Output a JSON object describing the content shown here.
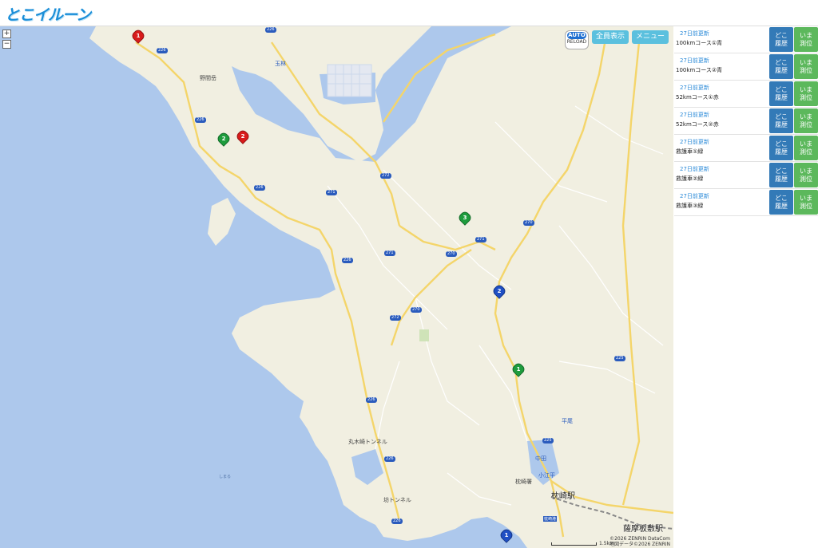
{
  "app": {
    "logo_text": "とこイルーン"
  },
  "map_controls": {
    "zoom_in": "+",
    "zoom_out": "−",
    "auto_label": "AUTO",
    "auto_sub": "RELOAD",
    "show_all": "全員表示",
    "menu": "メニュー"
  },
  "map_labels": {
    "mountain": "野間岳",
    "tunnel1": "丸木崎トンネル",
    "tunnel2": "坊トンネル",
    "bay": "しまる",
    "police": "枕崎署",
    "station1": "枕崎駅",
    "station2": "薩摩板敷駅",
    "port": "枕崎港",
    "small1": "玉林",
    "small2": "小江平",
    "small3": "中田",
    "small4": "平尾"
  },
  "routes": [
    "226",
    "226",
    "226",
    "226",
    "226",
    "226",
    "271",
    "271",
    "272",
    "272",
    "270",
    "270",
    "270",
    "271",
    "226",
    "225",
    "225",
    "226"
  ],
  "markers": [
    {
      "num": "1",
      "color": "#d81b1b"
    },
    {
      "num": "2",
      "color": "#d81b1b"
    },
    {
      "num": "2",
      "color": "#1e9c3d"
    },
    {
      "num": "3",
      "color": "#1e9c3d"
    },
    {
      "num": "2",
      "color": "#1f4fc4"
    },
    {
      "num": "1",
      "color": "#1e9c3d"
    },
    {
      "num": "1",
      "color": "#1f4fc4"
    }
  ],
  "attribution": {
    "line1": "©2026 ZENRIN DataCom",
    "line2": "地図データ©2026 ZENRIN",
    "scale": "1.5km"
  },
  "panel": {
    "doko_line1": "どこ",
    "doko_line2": "履歴",
    "ima_line1": "いま",
    "ima_line2": "測位",
    "rows": [
      {
        "updated": "27日前更新",
        "name": "100kmコース①青"
      },
      {
        "updated": "27日前更新",
        "name": "100kmコース②青"
      },
      {
        "updated": "27日前更新",
        "name": "52kmコース①赤"
      },
      {
        "updated": "27日前更新",
        "name": "52kmコース②赤"
      },
      {
        "updated": "27日前更新",
        "name": "救護車①緑"
      },
      {
        "updated": "27日前更新",
        "name": "救護車②緑"
      },
      {
        "updated": "27日前更新",
        "name": "救護車③緑"
      }
    ]
  }
}
